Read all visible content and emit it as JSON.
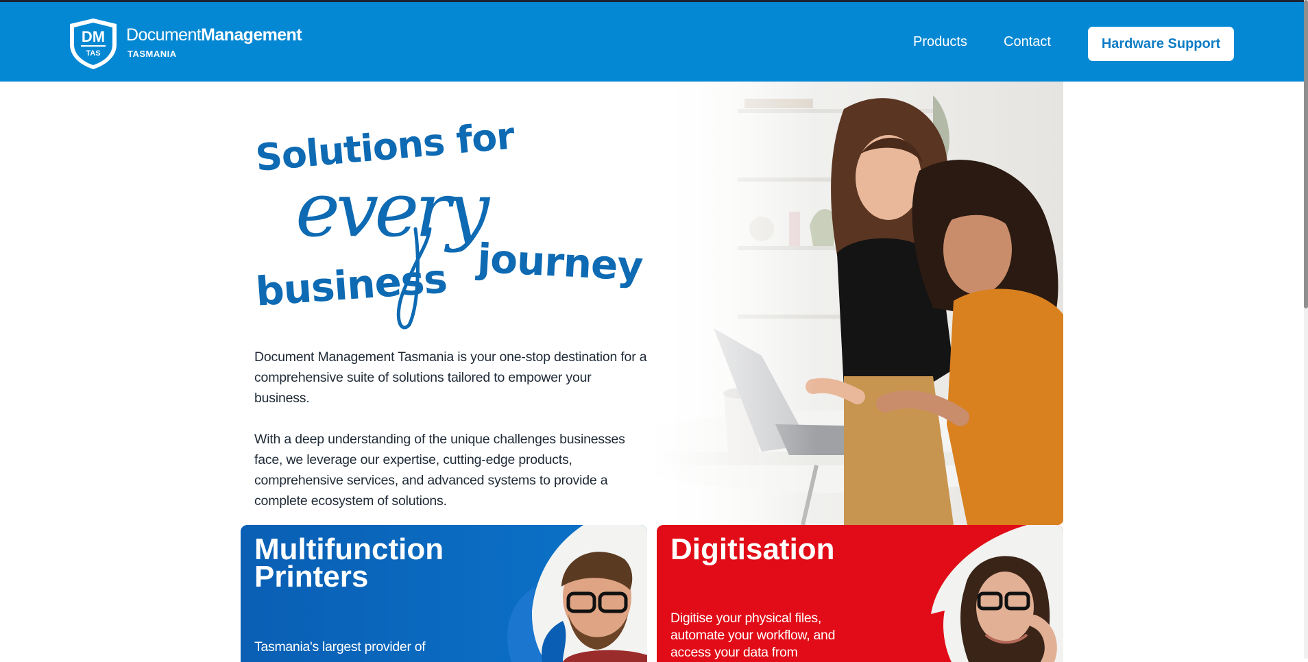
{
  "brand": {
    "badge_initials": "DM",
    "badge_sub": "TAS",
    "name_light": "Document",
    "name_bold": "Management",
    "region": "TASMANIA"
  },
  "nav": {
    "products": "Products",
    "contact": "Contact",
    "support_button": "Hardware Support"
  },
  "hero": {
    "headline_line1": "Solutions for",
    "headline_script": "every",
    "headline_left": "business",
    "headline_right": "journey",
    "paragraph_1": "Document Management Tasmania is your one-stop destination for a comprehensive suite of solutions tailored to empower your business.",
    "paragraph_2": "With a deep understanding of the unique challenges businesses face, we leverage our expertise, cutting-edge products, comprehensive services, and advanced systems to provide a complete ecosystem of solutions."
  },
  "cards": [
    {
      "title": "Multifunction Printers",
      "description": "Tasmania's largest provider of"
    },
    {
      "title": "Digitisation",
      "description": "Digitise your physical files, automate your workflow, and access your data from"
    }
  ],
  "colors": {
    "header_blue": "#0588d3",
    "headline_blue": "#0d6ab3",
    "card_blue": "#0a5fb4",
    "card_red": "#e10c17"
  }
}
